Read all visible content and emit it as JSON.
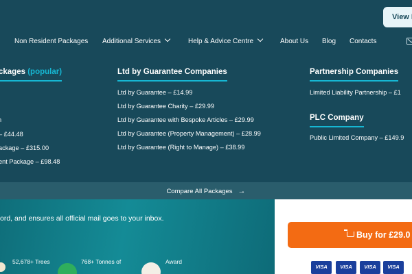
{
  "header": {
    "view_button": "View P"
  },
  "nav": {
    "items": [
      {
        "label": "Non Resident Packages"
      },
      {
        "label": "Additional Services"
      },
      {
        "label": "Help & Advice Centre"
      },
      {
        "label": "About Us"
      },
      {
        "label": "Blog"
      },
      {
        "label": "Contacts"
      }
    ]
  },
  "mega": {
    "col1": {
      "title": "ckages",
      "popular": "(popular)",
      "links": [
        "n",
        "– £44.48",
        "ackage – £315.00",
        "ent Package – £98.48"
      ]
    },
    "col2": {
      "title": "Ltd by Guarantee Companies",
      "links": [
        "Ltd by Guarantee – £14.99",
        "Ltd by Guarantee Charity – £29.99",
        "Ltd by Guarantee with Bespoke Articles – £29.99",
        "Ltd by Guarantee (Property Management) – £28.99",
        "Ltd by Guarantee (Right to Manage) – £38.99"
      ]
    },
    "col3": {
      "title": "Partnership Companies",
      "links": [
        "Limited Liability Partnership – £1"
      ]
    },
    "col4": {
      "title": "PLC Company",
      "links": [
        "Public Limited Company – £149.9"
      ]
    },
    "compare": "Compare All Packages"
  },
  "hero": {
    "text": "ord, and ensures all official mail goes to your inbox.",
    "badges": [
      "52,678+ Trees",
      "768+ Tonnes of",
      "Award"
    ]
  },
  "purchase": {
    "buy_label": "Buy for £29.0",
    "cards": [
      "VISA",
      "VISA",
      "VISA",
      "VISA"
    ]
  },
  "colors": {
    "accent": "#16b7d3",
    "buy": "#f36b13",
    "nav_bg": "#18495a"
  }
}
